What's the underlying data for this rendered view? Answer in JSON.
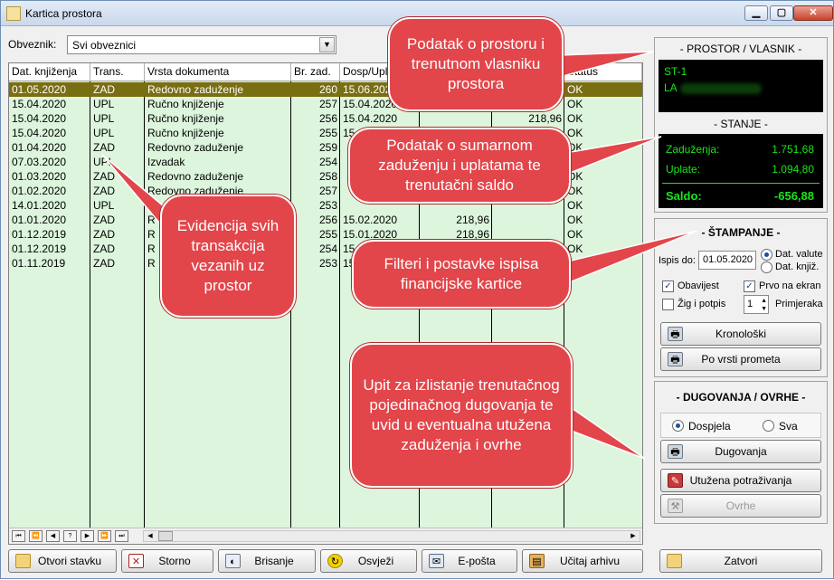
{
  "window": {
    "title": "Kartica prostora"
  },
  "filter": {
    "label": "Obveznik:",
    "value": "Svi obveznici"
  },
  "table": {
    "columns": [
      "Dat. knjiženja",
      "Trans.",
      "Vrsta dokumenta",
      "Br. zad.",
      "Dosp/Upl",
      "",
      "",
      "Status"
    ],
    "rows": [
      [
        "01.05.2020",
        "ZAD",
        "Redovno zaduženje",
        "260",
        "15.06.2020",
        "",
        "",
        "OK"
      ],
      [
        "15.04.2020",
        "UPL",
        "Ručno knjiženje",
        "257",
        "15.04.2020",
        "",
        "",
        "OK"
      ],
      [
        "15.04.2020",
        "UPL",
        "Ručno knjiženje",
        "256",
        "15.04.2020",
        "",
        "218,96",
        "OK"
      ],
      [
        "15.04.2020",
        "UPL",
        "Ručno knjiženje",
        "255",
        "15.04.2020",
        "",
        "",
        "OK"
      ],
      [
        "01.04.2020",
        "ZAD",
        "Redovno zaduženje",
        "259",
        "",
        "",
        "",
        "OK"
      ],
      [
        "07.03.2020",
        "UPL",
        "Izvadak",
        "254",
        "",
        "",
        "",
        "OK"
      ],
      [
        "01.03.2020",
        "ZAD",
        "Redovno zaduženje",
        "258",
        "",
        "",
        "",
        "OK"
      ],
      [
        "01.02.2020",
        "ZAD",
        "Redovno zaduženje",
        "257",
        "",
        "",
        "",
        "OK"
      ],
      [
        "14.01.2020",
        "UPL",
        "Ru",
        "253",
        "",
        "",
        "",
        "OK"
      ],
      [
        "01.01.2020",
        "ZAD",
        "R",
        "256",
        "15.02.2020",
        "218,96",
        "",
        "OK"
      ],
      [
        "01.12.2019",
        "ZAD",
        "R",
        "255",
        "15.01.2020",
        "218,96",
        "",
        "OK"
      ],
      [
        "01.12.2019",
        "ZAD",
        "R",
        "254",
        "15.1",
        "",
        "",
        "OK"
      ],
      [
        "01.11.2019",
        "ZAD",
        "R",
        "253",
        "15.",
        "",
        "",
        "OK"
      ]
    ]
  },
  "nav": [
    "⏮",
    "⏪",
    "◀",
    "?",
    "▶",
    "⏩",
    "⏭"
  ],
  "bottom_buttons": [
    {
      "label": "Otvori stavku",
      "icon": "folder-open-icon"
    },
    {
      "label": "Storno",
      "icon": "storno-icon"
    },
    {
      "label": "Brisanje",
      "icon": "eraser-icon"
    },
    {
      "label": "Osvježi",
      "icon": "refresh-icon"
    },
    {
      "label": "E-pošta",
      "icon": "email-icon"
    },
    {
      "label": "Učitaj arhivu",
      "icon": "archive-icon"
    }
  ],
  "close_button": {
    "label": "Zatvori",
    "icon": "folder-icon"
  },
  "prostor": {
    "title": "- PROSTOR / VLASNIK -",
    "line1": "ST-1",
    "line2": "LA"
  },
  "stanje": {
    "title": "- STANJE -",
    "zaduzenja_label": "Zaduženja:",
    "zaduzenja_value": "1.751,68",
    "uplate_label": "Uplate:",
    "uplate_value": "1.094,80",
    "saldo_label": "Saldo:",
    "saldo_value": "-656,88"
  },
  "stampanje": {
    "title": "- ŠTAMPANJE -",
    "ispis_label": "Ispis do:",
    "ispis_value": "01.05.2020",
    "radio1": "Dat. valute",
    "radio2": "Dat. knjiž.",
    "obavijest": "Obavijest",
    "prvo_na_ekran": "Prvo na ekran",
    "zig": "Žig i potpis",
    "primjeraka_value": "1",
    "primjeraka_label": "Primjeraka",
    "kronoloski": "Kronološki",
    "po_vrsti": "Po vrsti prometa"
  },
  "dugovanja": {
    "title": "- DUGOVANJA / OVRHE -",
    "radio1": "Dospjela",
    "radio2": "Sva",
    "dugovanja_btn": "Dugovanja",
    "utuzena_btn": "Utužena potraživanja",
    "ovrhe_btn": "Ovrhe"
  },
  "callouts": {
    "c1": "Podatak o prostoru i trenutnom vlasniku prostora",
    "c2": "Podatak o sumarnom zaduženju i uplatama te trenutačni saldo",
    "c3": "Evidencija svih transakcija vezanih uz prostor",
    "c4": "Filteri i postavke ispisa financijske kartice",
    "c5": "Upit za izlistanje trenutačnog pojedinačnog dugovanja te uvid u eventualna utužena zaduženja i ovrhe"
  },
  "colors": {
    "callout": "#e2454a",
    "grid_bg": "#dcf5dc",
    "selected_row": "#7a6e12",
    "lcd_green": "#19e619"
  }
}
